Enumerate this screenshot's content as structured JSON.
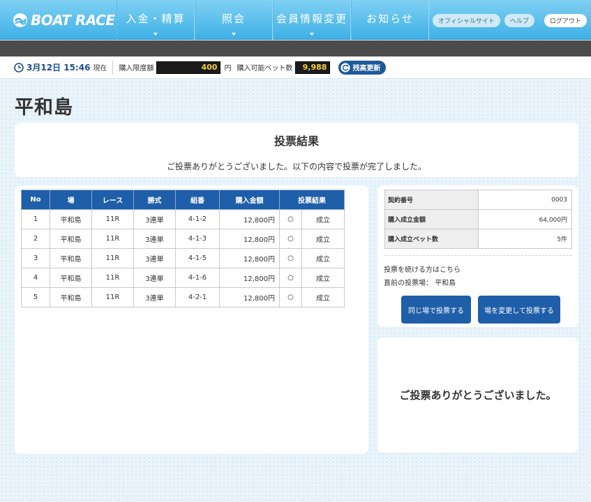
{
  "header": {
    "logo_text": "BOAT RACE",
    "nav": [
      "入金・精算",
      "照会",
      "会員情報変更",
      "お知らせ"
    ],
    "links": [
      "オフィシャルサイト",
      "ヘルプ",
      "ログアウト"
    ]
  },
  "status": {
    "time": "3月12日 15:46",
    "time_suffix": "現在",
    "limit_label": "購入限度額",
    "limit_value": "400",
    "limit_unit": "円",
    "bet_label": "購入可能ベット数",
    "bet_value": "9,988",
    "refresh_label": "残高更新"
  },
  "page": {
    "title": "平和島"
  },
  "result": {
    "title": "投票結果",
    "message": "ご投票ありがとうございました。以下の内容で投票が完了しました。"
  },
  "bets_table": {
    "headers": [
      "No",
      "場",
      "レース",
      "勝式",
      "組番",
      "購入金額",
      "投票結果"
    ],
    "rows": [
      {
        "no": "1",
        "venue": "平和島",
        "race": "11R",
        "type": "3連単",
        "combo": "4-1-2",
        "amount": "12,800円",
        "mark": "○",
        "result": "成立"
      },
      {
        "no": "2",
        "venue": "平和島",
        "race": "11R",
        "type": "3連単",
        "combo": "4-1-3",
        "amount": "12,800円",
        "mark": "○",
        "result": "成立"
      },
      {
        "no": "3",
        "venue": "平和島",
        "race": "11R",
        "type": "3連単",
        "combo": "4-1-5",
        "amount": "12,800円",
        "mark": "○",
        "result": "成立"
      },
      {
        "no": "4",
        "venue": "平和島",
        "race": "11R",
        "type": "3連単",
        "combo": "4-1-6",
        "amount": "12,800円",
        "mark": "○",
        "result": "成立"
      },
      {
        "no": "5",
        "venue": "平和島",
        "race": "11R",
        "type": "3連単",
        "combo": "4-2-1",
        "amount": "12,800円",
        "mark": "○",
        "result": "成立"
      }
    ]
  },
  "summary": {
    "contract_label": "契約番号",
    "contract_value": "0003",
    "amount_label": "購入成立金額",
    "amount_value": "64,000円",
    "bets_label": "購入成立ベット数",
    "bets_value": "5件",
    "continue_text": "投票を続ける方はこちら",
    "prev_venue_text": "直前の投票場： 平和島",
    "same_venue_button": "同じ場で投票する",
    "change_venue_button": "場を変更して投票する"
  },
  "thanks": {
    "message": "ご投票ありがとうございました。"
  },
  "colors": {
    "header_blue": "#3fb0e6",
    "table_header": "#1f5ea8",
    "amount_yellow": "#f4d23b"
  }
}
